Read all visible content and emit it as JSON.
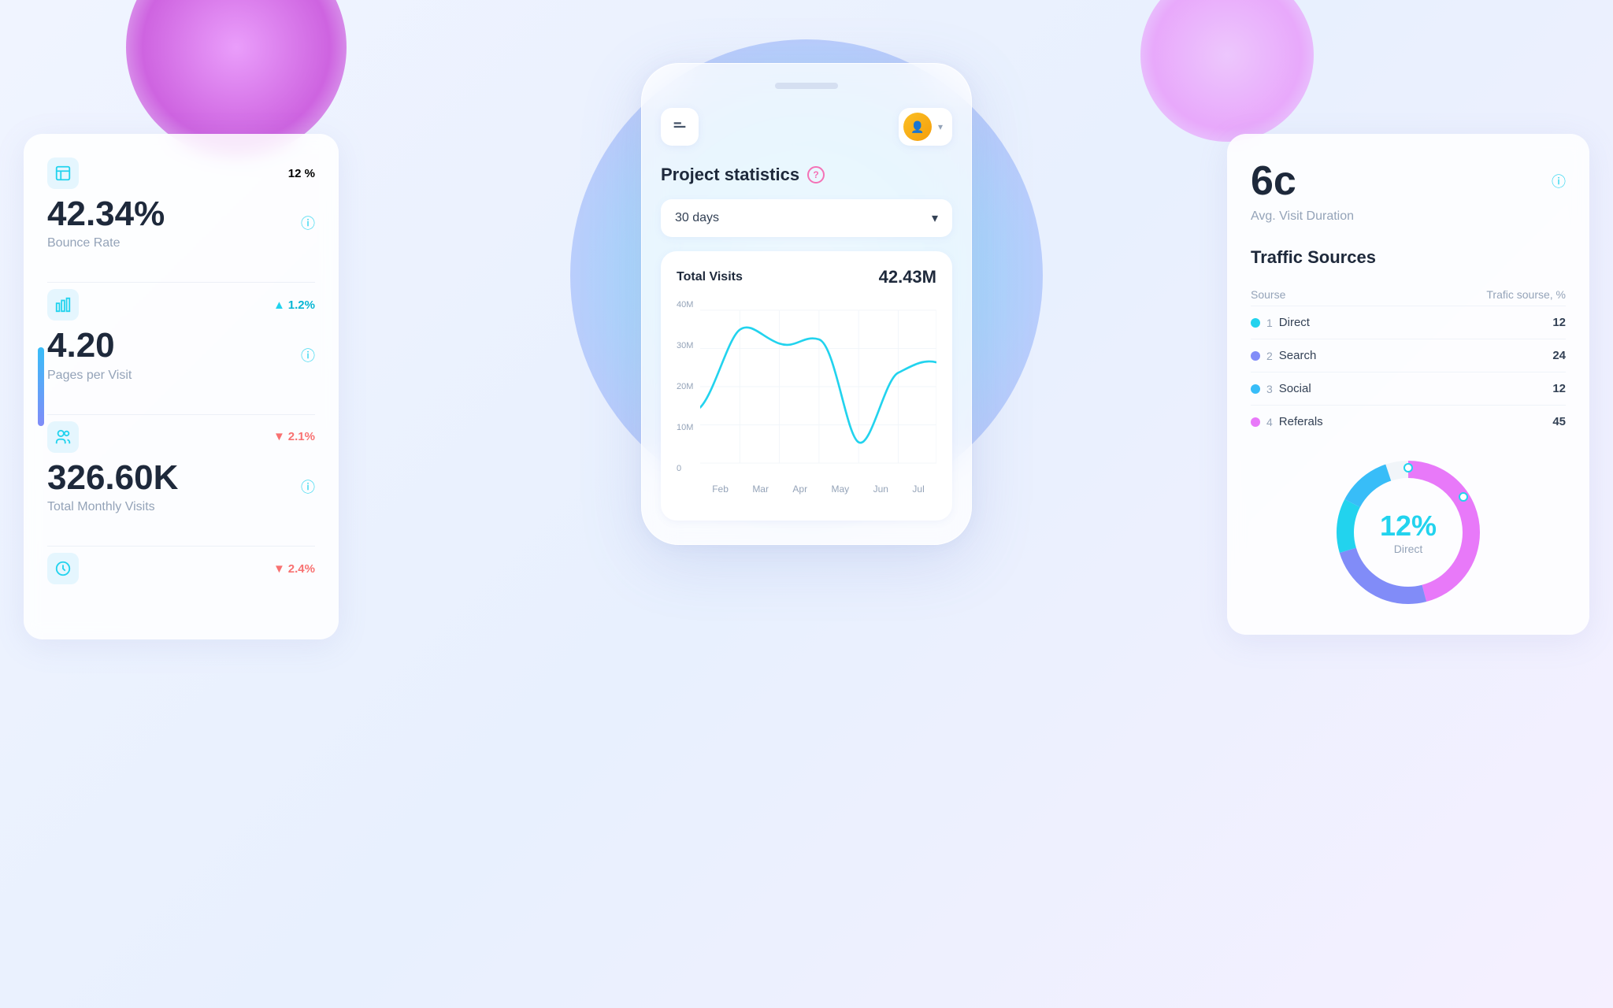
{
  "background": {
    "colors": [
      "#f0f4ff",
      "#e8f0fe",
      "#f5f0ff"
    ]
  },
  "left_card": {
    "metrics": [
      {
        "icon": "chart-icon",
        "change_label": "12 %",
        "change_dir": "neutral",
        "value": "42.34%",
        "label": "Bounce Rate",
        "has_help": true
      },
      {
        "icon": "bar-icon",
        "change_label": "1.2%",
        "change_dir": "up",
        "value": "4.20",
        "label": "Pages per Visit",
        "has_help": true
      },
      {
        "icon": "users-icon",
        "change_label": "2.1%",
        "change_dir": "down",
        "value": "326.60K",
        "label": "Total Monthly Visits",
        "has_help": true
      },
      {
        "icon": "clock-icon",
        "change_label": "2.4%",
        "change_dir": "down",
        "value": ""
      }
    ]
  },
  "phone": {
    "title": "Project statistics",
    "period_label": "30 days",
    "period_arrow": "▾",
    "chart": {
      "title": "Total Visits",
      "total": "42.43M",
      "y_labels": [
        "40M",
        "30M",
        "20M",
        "10M",
        "0"
      ],
      "x_labels": [
        "Feb",
        "Mar",
        "Apr",
        "May",
        "Jun",
        "Jul"
      ]
    }
  },
  "right_card": {
    "avg_label": "Avg. Visit Duration",
    "big_number": "6c",
    "traffic_title": "Traffic Sources",
    "table_headers": {
      "source": "Sourse",
      "percent": "Trafic sourse, %"
    },
    "sources": [
      {
        "num": 1,
        "dot_color": "#22d3ee",
        "name": "Direct",
        "value": 12
      },
      {
        "num": 2,
        "dot_color": "#818cf8",
        "name": "Search",
        "value": 24
      },
      {
        "num": 3,
        "dot_color": "#38bdf8",
        "name": "Social",
        "value": 12
      },
      {
        "num": 4,
        "dot_color": "#e879f9",
        "name": "Referals",
        "value": 45
      }
    ],
    "donut": {
      "percent": "12%",
      "label": "Direct",
      "segments": [
        {
          "color": "#22d3ee",
          "value": 12
        },
        {
          "color": "#818cf8",
          "value": 24
        },
        {
          "color": "#38bdf8",
          "value": 12
        },
        {
          "color": "#e879f9",
          "value": 45
        },
        {
          "color": "#f0abfc",
          "value": 7
        }
      ]
    }
  }
}
